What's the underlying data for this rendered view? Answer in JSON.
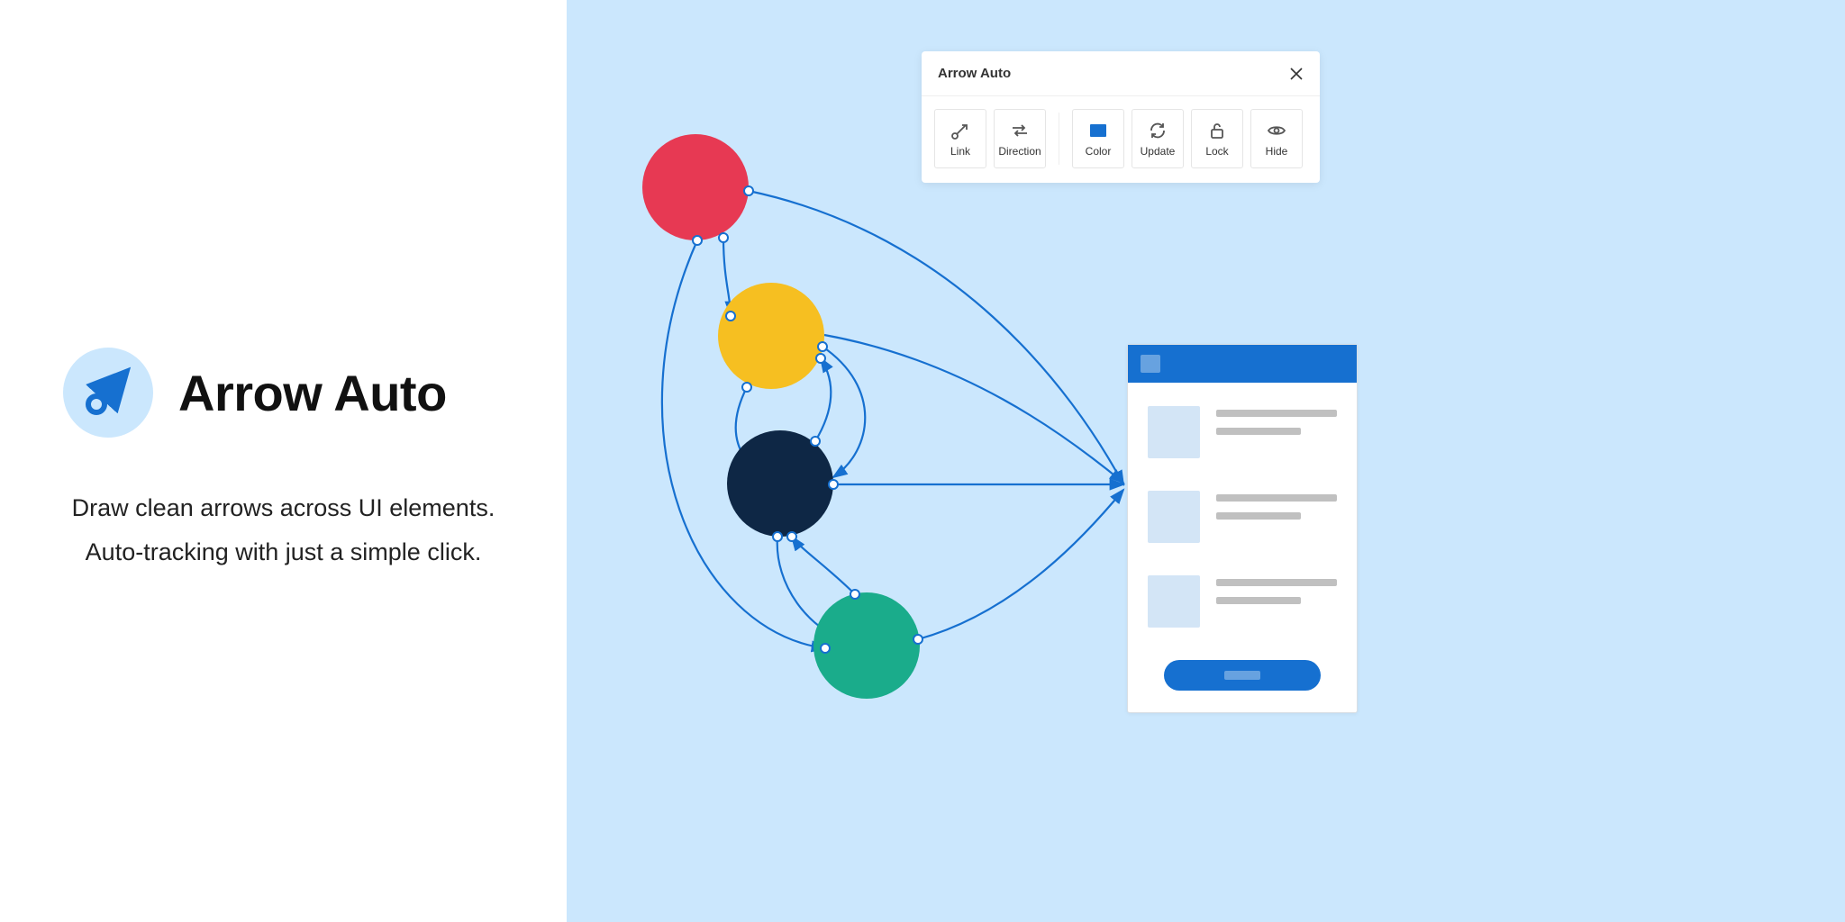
{
  "hero": {
    "title": "Arrow Auto",
    "subtitle1": "Draw clean arrows across UI elements.",
    "subtitle2": "Auto-tracking with just a simple click."
  },
  "toolbar": {
    "title": "Arrow Auto",
    "buttons": {
      "link": "Link",
      "direction": "Direction",
      "color": "Color",
      "update": "Update",
      "lock": "Lock",
      "hide": "Hide"
    }
  },
  "colors": {
    "accent": "#1670d0",
    "red": "#e73953",
    "yellow": "#f6bf21",
    "navy": "#0e2745",
    "teal": "#1aac8b",
    "canvasBg": "#cbe7fd"
  }
}
